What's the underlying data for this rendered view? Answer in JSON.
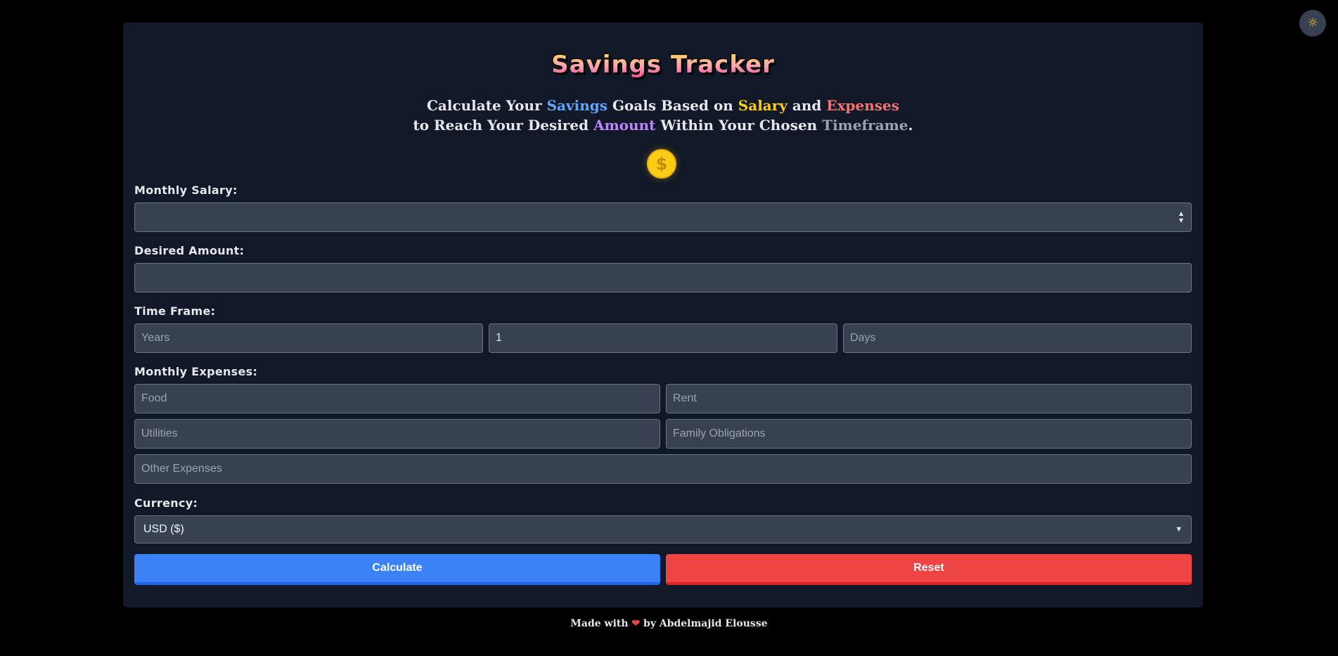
{
  "theme_toggle": {
    "icon": "sun-icon",
    "glyph": "☼"
  },
  "header": {
    "title": "Savings Tracker",
    "subtitle": {
      "w1": "Calculate Your ",
      "savings": "Savings",
      "w2": " Goals Based on ",
      "salary": "Salary",
      "w3": " and ",
      "expenses": "Expenses",
      "w4": "to Reach Your Desired ",
      "amount": "Amount",
      "w5": " Within Your Chosen ",
      "timeframe": "Timeframe",
      "w6": "."
    },
    "coin_glyph": "$"
  },
  "form": {
    "salary_label": "Monthly Salary:",
    "salary_value": "",
    "desired_label": "Desired Amount:",
    "desired_value": "",
    "timeframe_label": "Time Frame:",
    "years_placeholder": "Years",
    "months_value": "1",
    "days_placeholder": "Days",
    "expenses_label": "Monthly Expenses:",
    "food_placeholder": "Food",
    "rent_placeholder": "Rent",
    "utilities_placeholder": "Utilities",
    "family_placeholder": "Family Obligations",
    "other_placeholder": "Other Expenses",
    "currency_label": "Currency:",
    "currency_selected": "USD ($)"
  },
  "buttons": {
    "calculate": "Calculate",
    "reset": "Reset"
  },
  "footer": {
    "made_with": "Made with",
    "heart": "❤",
    "by": "by Abdelmajid Elousse"
  },
  "colors": {
    "background": "#000000",
    "card": "#111827",
    "input": "#374151",
    "calculate": "#3b82f6",
    "reset": "#ef4444",
    "coin": "#facc15"
  }
}
